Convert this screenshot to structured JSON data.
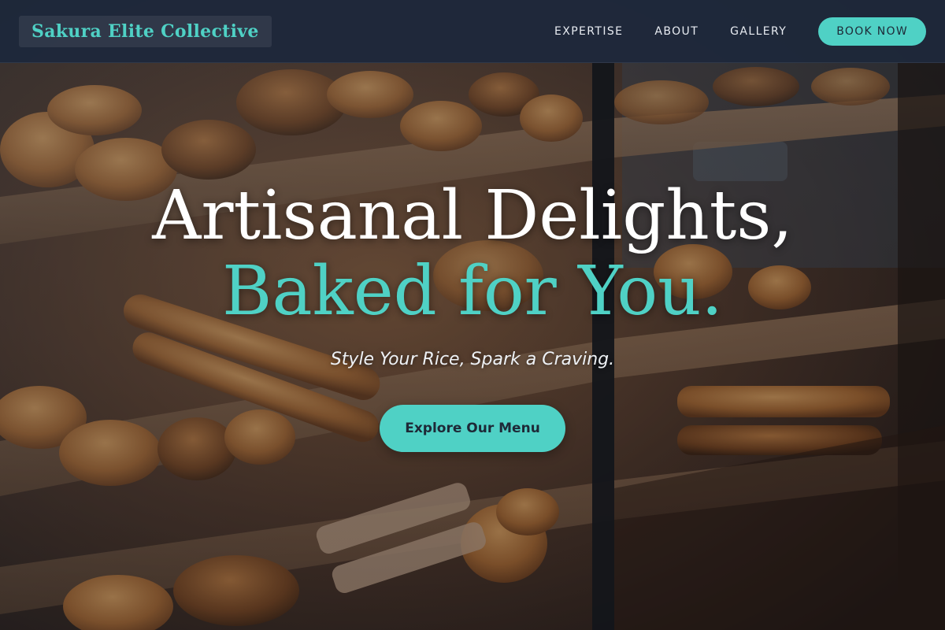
{
  "header": {
    "brand": "Sakura Elite Collective",
    "nav": [
      {
        "label": "EXPERTISE"
      },
      {
        "label": "ABOUT"
      },
      {
        "label": "GALLERY"
      }
    ],
    "cta_label": "BOOK NOW"
  },
  "hero": {
    "headline_line1": "Artisanal Delights,",
    "headline_line2": "Baked for You.",
    "tagline": "Style Your Rice, Spark a Craving.",
    "cta_label": "Explore Our Menu",
    "background": "bakery-display-case-photo"
  },
  "colors": {
    "accent": "#4fd1c5",
    "header_bg": "#1e293b",
    "text_light": "#ffffff"
  }
}
